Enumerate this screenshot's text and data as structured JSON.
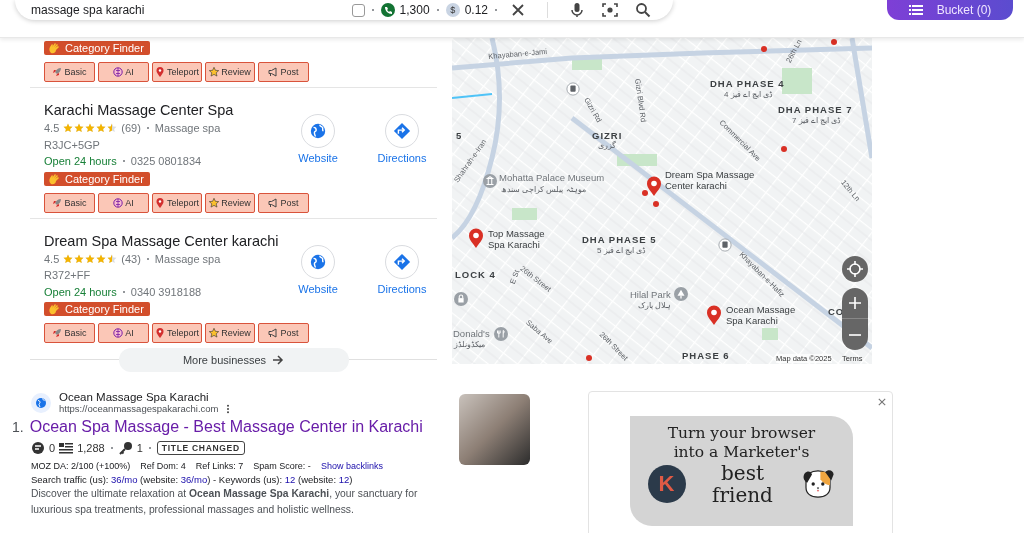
{
  "search_bar": {
    "query": "massage spa karachi",
    "checked": false,
    "volume": "1,300",
    "cpc_symbol": "$",
    "cpc": "0.12"
  },
  "bucket_button": {
    "label": "Bucket (0)"
  },
  "businesses": [
    {
      "category_finder": "Category Finder",
      "tools": [
        {
          "kind": "basic",
          "label": "Basic"
        },
        {
          "kind": "ai",
          "label": "AI"
        },
        {
          "kind": "teleport",
          "label": "Teleport"
        },
        {
          "kind": "review",
          "label": "Review"
        },
        {
          "kind": "post",
          "label": "Post"
        }
      ]
    },
    {
      "name": "Karachi Massage Center Spa",
      "rating": "4.5",
      "stars": 4.5,
      "reviews": "(69)",
      "category": "Massage spa",
      "plus_code": "R3JC+5GP",
      "hours": "Open 24 hours",
      "phone": "0325 0801834",
      "website": "Website",
      "directions": "Directions",
      "category_finder": "Category Finder",
      "tools": [
        {
          "kind": "basic",
          "label": "Basic"
        },
        {
          "kind": "ai",
          "label": "AI"
        },
        {
          "kind": "teleport",
          "label": "Teleport"
        },
        {
          "kind": "review",
          "label": "Review"
        },
        {
          "kind": "post",
          "label": "Post"
        }
      ]
    },
    {
      "name": "Dream Spa Massage Center karachi",
      "rating": "4.5",
      "stars": 4.5,
      "reviews": "(43)",
      "category": "Massage spa",
      "plus_code": "R372+FF",
      "hours": "Open 24 hours",
      "phone": "0340 3918188",
      "website": "Website",
      "directions": "Directions",
      "category_finder": "Category Finder",
      "tools": [
        {
          "kind": "basic",
          "label": "Basic"
        },
        {
          "kind": "ai",
          "label": "AI"
        },
        {
          "kind": "teleport",
          "label": "Teleport"
        },
        {
          "kind": "review",
          "label": "Review"
        },
        {
          "kind": "post",
          "label": "Post"
        }
      ]
    }
  ],
  "more_businesses": "More businesses",
  "map": {
    "labels": [
      {
        "kind": "road",
        "text": "Khayaban-e-Jami"
      },
      {
        "kind": "area",
        "text": "DHA PHASE 4"
      },
      {
        "kind": "area-urdu",
        "text": "ڈی ایچ اے فیز 4"
      },
      {
        "kind": "road",
        "text": "26th Ln"
      },
      {
        "kind": "area",
        "text": "DHA PHASE 7"
      },
      {
        "kind": "area-urdu",
        "text": "ڈی ایچ اے فیز 7"
      },
      {
        "kind": "road",
        "text": "Gizri Blvd Rd"
      },
      {
        "kind": "road",
        "text": "Gizri Rd"
      },
      {
        "kind": "area",
        "text": "GIZRI"
      },
      {
        "kind": "area-urdu",
        "text": "گزری"
      },
      {
        "kind": "road",
        "text": "Commercial Ave"
      },
      {
        "kind": "road",
        "text": "12th Ln"
      },
      {
        "kind": "area",
        "text": "5"
      },
      {
        "kind": "road",
        "text": "Shahrah-e-Iran"
      },
      {
        "kind": "place",
        "text": "Mohatta Palace Museum"
      },
      {
        "kind": "place-urdu",
        "text": "موہٹہ پیلس کراچی سندھ"
      },
      {
        "kind": "pin",
        "text": "Dream Spa Massage Center karachi"
      },
      {
        "kind": "pin",
        "text": "Top Massage Spa Karachi"
      },
      {
        "kind": "area",
        "text": "DHA PHASE 5"
      },
      {
        "kind": "area-urdu",
        "text": "ڈی ایچ اے فیز 5"
      },
      {
        "kind": "area",
        "text": "LOCK 4"
      },
      {
        "kind": "road",
        "text": "E St"
      },
      {
        "kind": "road",
        "text": "26th Street"
      },
      {
        "kind": "road",
        "text": "Khayaban-e-Hafiz"
      },
      {
        "kind": "place",
        "text": "Hilal Park"
      },
      {
        "kind": "place-urdu",
        "text": "ہلال پارک"
      },
      {
        "kind": "pin",
        "text": "Ocean Massage Spa Karachi"
      },
      {
        "kind": "area",
        "text": "CO"
      },
      {
        "kind": "road",
        "text": "Saba Ave"
      },
      {
        "kind": "place",
        "text": "Donald's"
      },
      {
        "kind": "place-urdu",
        "text": "میکڈونلڈز"
      },
      {
        "kind": "road",
        "text": "26th Street"
      },
      {
        "kind": "area",
        "text": "PHASE 6"
      }
    ],
    "attribution": "Map data ©2025",
    "terms": "Terms"
  },
  "result": {
    "site_name": "Ocean Massage Spa Karachi",
    "url": "https://oceanmassagespakarachi.com",
    "number": "1.",
    "title": "Ocean Spa Massage - Best Massage Center in Karachi",
    "metrics": [
      "0",
      "1,288",
      "1"
    ],
    "badge": "TITLE CHANGED",
    "seo_stats": [
      "MOZ DA: 2/100 (+100%)",
      "Ref Dom: 4",
      "Ref Links: 7",
      "Spam Score: -"
    ],
    "backlinks_link": "Show backlinks",
    "traffic": [
      {
        "kind": "text",
        "text": "Search traffic (us): "
      },
      {
        "kind": "link",
        "text": "36/mo"
      },
      {
        "kind": "text",
        "text": " (website: "
      },
      {
        "kind": "link",
        "text": "36/mo"
      },
      {
        "kind": "text",
        "text": ") - Keywords (us): "
      },
      {
        "kind": "link",
        "text": "12"
      },
      {
        "kind": "text",
        "text": " (website: "
      },
      {
        "kind": "link",
        "text": "12"
      },
      {
        "kind": "text",
        "text": ")"
      }
    ],
    "description": "Discover the ultimate relaxation at **Ocean Massage Spa Karachi**, your sanctuary for luxurious spa treatments, professional massages and holistic wellness."
  },
  "ad": {
    "headline": "Turn your browser into a Marketer's",
    "emphasis": "best friend",
    "logo_letter": "K"
  }
}
